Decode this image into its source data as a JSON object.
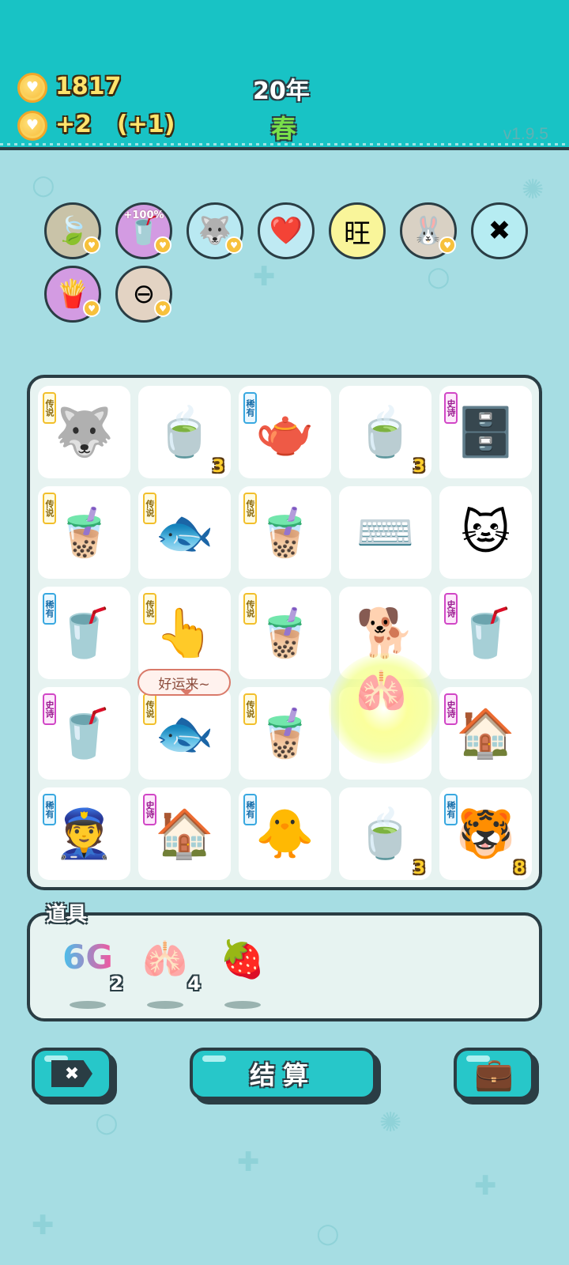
{
  "header": {
    "coins": "1817",
    "income": "+2",
    "bonus": "(+1)",
    "year": "20年",
    "season": "春",
    "version": "v1.9.5",
    "coin_icon": "heart-coin-icon"
  },
  "buffs": [
    {
      "name": "leaf-icon",
      "glyph": "🍃",
      "bg": "#c9c3a8",
      "tag": ""
    },
    {
      "name": "milk-tea-boost-icon",
      "glyph": "🥤",
      "bg": "#d39be2",
      "tag": "+100%"
    },
    {
      "name": "husky-icon",
      "glyph": "🐺",
      "bg": "#b9e9f2",
      "tag": ""
    },
    {
      "name": "heart-fan-icon",
      "glyph": "❤️",
      "bg": "#bfeaf3",
      "tag": ""
    },
    {
      "name": "wang-tiles-icon",
      "glyph": "旺",
      "bg": "#f9f59a",
      "tag": ""
    },
    {
      "name": "rabbit-icon",
      "glyph": "🐰",
      "bg": "#d9d1c4",
      "tag": ""
    },
    {
      "name": "sticks-icon",
      "glyph": "✖",
      "bg": "#b6ecf2",
      "tag": ""
    },
    {
      "name": "fries-icon",
      "glyph": "🍟",
      "bg": "#d39be2",
      "tag": ""
    },
    {
      "name": "minus-icon",
      "glyph": "⊖",
      "bg": "#e3d3c3",
      "tag": ""
    }
  ],
  "board": {
    "bubble_text": "好运来~",
    "glow_item": "🫁",
    "cells": [
      {
        "name": "husky-king",
        "glyph": "🐺",
        "badge": "传说",
        "badge_type": "legend",
        "count": ""
      },
      {
        "name": "tea-bowl",
        "glyph": "🍵",
        "badge": "",
        "badge_type": "",
        "count": "3"
      },
      {
        "name": "teapot",
        "glyph": "🫖",
        "badge": "稀有",
        "badge_type": "rare",
        "count": ""
      },
      {
        "name": "tea-bowl",
        "glyph": "🍵",
        "badge": "",
        "badge_type": "",
        "count": "3"
      },
      {
        "name": "server-rack",
        "glyph": "🗄️",
        "badge": "史诗",
        "badge_type": "epic",
        "count": ""
      },
      {
        "name": "milk-tea-large",
        "glyph": "🧋",
        "badge": "传说",
        "badge_type": "legend",
        "count": ""
      },
      {
        "name": "koi-fish-marked",
        "glyph": "🐟",
        "badge": "传说",
        "badge_type": "legend",
        "count": ""
      },
      {
        "name": "milk-tea-large",
        "glyph": "🧋",
        "badge": "传说",
        "badge_type": "legend",
        "count": ""
      },
      {
        "name": "keyboard",
        "glyph": "⌨️",
        "badge": "",
        "badge_type": "",
        "count": ""
      },
      {
        "name": "cat",
        "glyph": "🐱",
        "badge": "",
        "badge_type": "",
        "count": ""
      },
      {
        "name": "milk-tea-small",
        "glyph": "🥤",
        "badge": "稀有",
        "badge_type": "rare",
        "count": ""
      },
      {
        "name": "pointing-hand",
        "glyph": "👆",
        "badge": "传说",
        "badge_type": "legend",
        "count": ""
      },
      {
        "name": "milk-tea-large",
        "glyph": "🧋",
        "badge": "传说",
        "badge_type": "legend",
        "count": ""
      },
      {
        "name": "husky-dog",
        "glyph": "🐕",
        "badge": "",
        "badge_type": "",
        "count": ""
      },
      {
        "name": "milk-tea-tall",
        "glyph": "🥤",
        "badge": "史诗",
        "badge_type": "epic",
        "count": ""
      },
      {
        "name": "milk-tea-tall",
        "glyph": "🥤",
        "badge": "史诗",
        "badge_type": "epic",
        "count": ""
      },
      {
        "name": "koi-fish",
        "glyph": "🐟",
        "badge": "传说",
        "badge_type": "legend",
        "count": ""
      },
      {
        "name": "milk-tea-large",
        "glyph": "🧋",
        "badge": "传说",
        "badge_type": "legend",
        "count": ""
      },
      {
        "name": "cat-faded",
        "glyph": "",
        "badge": "",
        "badge_type": "",
        "count": ""
      },
      {
        "name": "rabbit-house",
        "glyph": "🏠",
        "badge": "史诗",
        "badge_type": "epic",
        "count": ""
      },
      {
        "name": "police-boy",
        "glyph": "👮",
        "badge": "稀有",
        "badge_type": "rare",
        "count": ""
      },
      {
        "name": "rabbit-house",
        "glyph": "🏠",
        "badge": "史诗",
        "badge_type": "epic",
        "count": ""
      },
      {
        "name": "chick",
        "glyph": "🐥",
        "badge": "稀有",
        "badge_type": "rare",
        "count": ""
      },
      {
        "name": "tea-bowl",
        "glyph": "🍵",
        "badge": "",
        "badge_type": "",
        "count": "3"
      },
      {
        "name": "tiger",
        "glyph": "🐯",
        "badge": "稀有",
        "badge_type": "rare",
        "count": "8"
      }
    ]
  },
  "tools": {
    "title": "道具",
    "items": [
      {
        "name": "6g-item",
        "label": "6G",
        "count": "2"
      },
      {
        "name": "liver-item",
        "label": "🫁",
        "count": "4"
      },
      {
        "name": "bayberry-item",
        "label": "🍓",
        "count": ""
      }
    ]
  },
  "buttons": {
    "exit_icon": "✖",
    "settle_label": "结算",
    "bag_icon": "💼"
  },
  "colors": {
    "header_bg": "#18c3c5",
    "page_bg": "#a6dde3",
    "outline": "#2a3d44",
    "button": "#27c7c9"
  }
}
